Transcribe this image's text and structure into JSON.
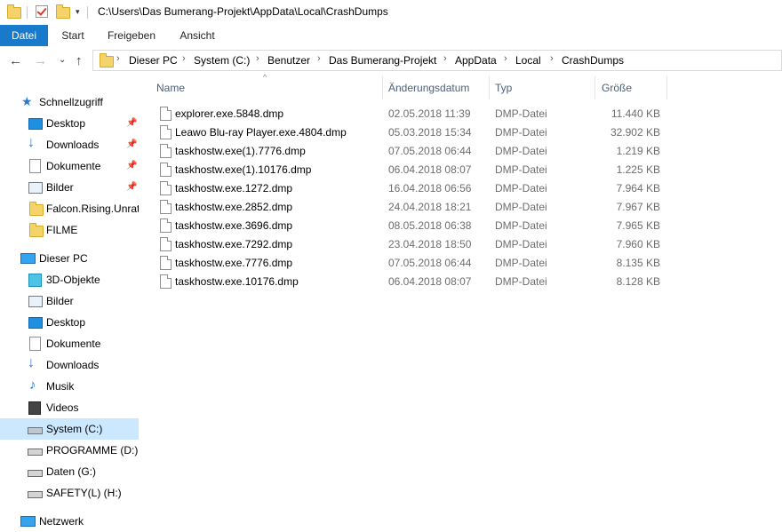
{
  "window": {
    "title": "C:\\Users\\Das Bumerang-Projekt\\AppData\\Local\\CrashDumps"
  },
  "ribbon": {
    "tabs": [
      "Datei",
      "Start",
      "Freigeben",
      "Ansicht"
    ]
  },
  "breadcrumb": [
    "Dieser PC",
    "System (C:)",
    "Benutzer",
    "Das Bumerang-Projekt",
    "AppData",
    "Local",
    "CrashDumps"
  ],
  "sidebar": {
    "quick_access": "Schnellzugriff",
    "quick_items": [
      "Desktop",
      "Downloads",
      "Dokumente",
      "Bilder",
      "Falcon.Rising.Unrat",
      "FILME"
    ],
    "this_pc": "Dieser PC",
    "pc_items": [
      "3D-Objekte",
      "Bilder",
      "Desktop",
      "Dokumente",
      "Downloads",
      "Musik",
      "Videos",
      "System (C:)",
      "PROGRAMME (D:)",
      "Daten (G:)",
      "SAFETY(L) (H:)"
    ],
    "network": "Netzwerk"
  },
  "columns": {
    "name": "Name",
    "date": "Änderungsdatum",
    "type": "Typ",
    "size": "Größe"
  },
  "files": [
    {
      "name": "explorer.exe.5848.dmp",
      "date": "02.05.2018 11:39",
      "type": "DMP-Datei",
      "size": "11.440 KB"
    },
    {
      "name": "Leawo Blu-ray Player.exe.4804.dmp",
      "date": "05.03.2018 15:34",
      "type": "DMP-Datei",
      "size": "32.902 KB"
    },
    {
      "name": "taskhostw.exe(1).7776.dmp",
      "date": "07.05.2018 06:44",
      "type": "DMP-Datei",
      "size": "1.219 KB"
    },
    {
      "name": "taskhostw.exe(1).10176.dmp",
      "date": "06.04.2018 08:07",
      "type": "DMP-Datei",
      "size": "1.225 KB"
    },
    {
      "name": "taskhostw.exe.1272.dmp",
      "date": "16.04.2018 06:56",
      "type": "DMP-Datei",
      "size": "7.964 KB"
    },
    {
      "name": "taskhostw.exe.2852.dmp",
      "date": "24.04.2018 18:21",
      "type": "DMP-Datei",
      "size": "7.967 KB"
    },
    {
      "name": "taskhostw.exe.3696.dmp",
      "date": "08.05.2018 06:38",
      "type": "DMP-Datei",
      "size": "7.965 KB"
    },
    {
      "name": "taskhostw.exe.7292.dmp",
      "date": "23.04.2018 18:50",
      "type": "DMP-Datei",
      "size": "7.960 KB"
    },
    {
      "name": "taskhostw.exe.7776.dmp",
      "date": "07.05.2018 06:44",
      "type": "DMP-Datei",
      "size": "8.135 KB"
    },
    {
      "name": "taskhostw.exe.10176.dmp",
      "date": "06.04.2018 08:07",
      "type": "DMP-Datei",
      "size": "8.128 KB"
    }
  ]
}
